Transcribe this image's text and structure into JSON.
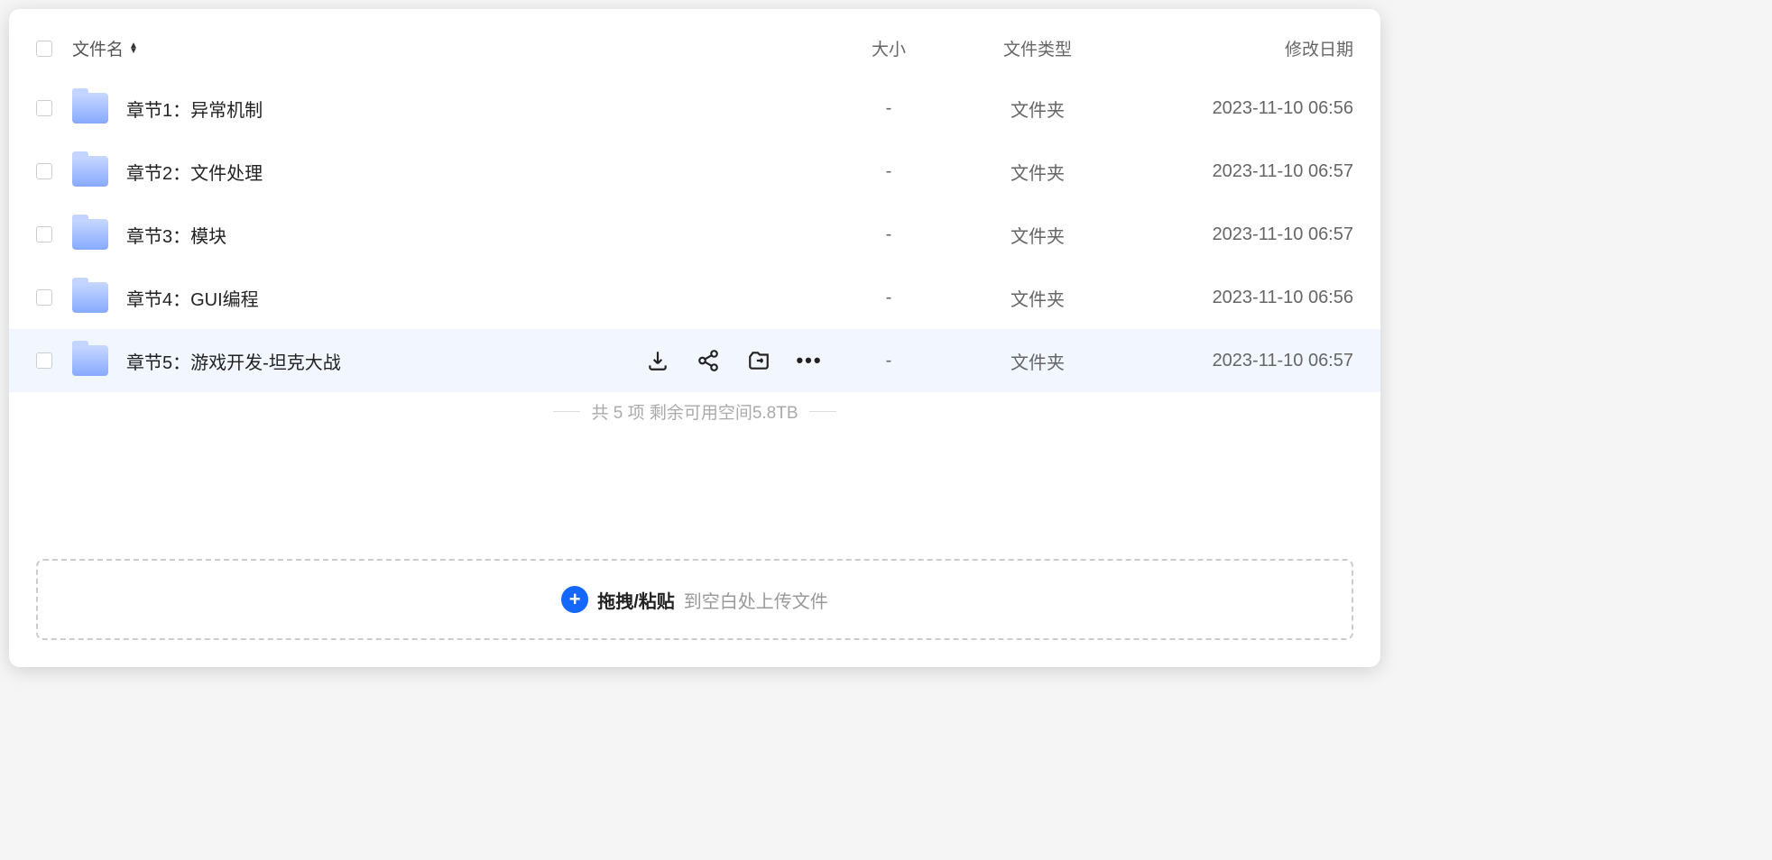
{
  "columns": {
    "name": "文件名",
    "size": "大小",
    "type": "文件类型",
    "date": "修改日期"
  },
  "files": [
    {
      "name": "章节1：异常机制",
      "size": "-",
      "type": "文件夹",
      "date": "2023-11-10 06:56",
      "hovered": false
    },
    {
      "name": "章节2：文件处理",
      "size": "-",
      "type": "文件夹",
      "date": "2023-11-10 06:57",
      "hovered": false
    },
    {
      "name": "章节3：模块",
      "size": "-",
      "type": "文件夹",
      "date": "2023-11-10 06:57",
      "hovered": false
    },
    {
      "name": "章节4：GUI编程",
      "size": "-",
      "type": "文件夹",
      "date": "2023-11-10 06:56",
      "hovered": false
    },
    {
      "name": "章节5：游戏开发-坦克大战",
      "size": "-",
      "type": "文件夹",
      "date": "2023-11-10 06:57",
      "hovered": true
    }
  ],
  "row_actions": {
    "download": "download-icon",
    "share": "share-icon",
    "move": "move-icon",
    "more": "more-icon"
  },
  "summary": "共 5 项 剩余可用空间5.8TB",
  "dropzone": {
    "strong": "拖拽/粘贴",
    "muted": "到空白处上传文件"
  }
}
